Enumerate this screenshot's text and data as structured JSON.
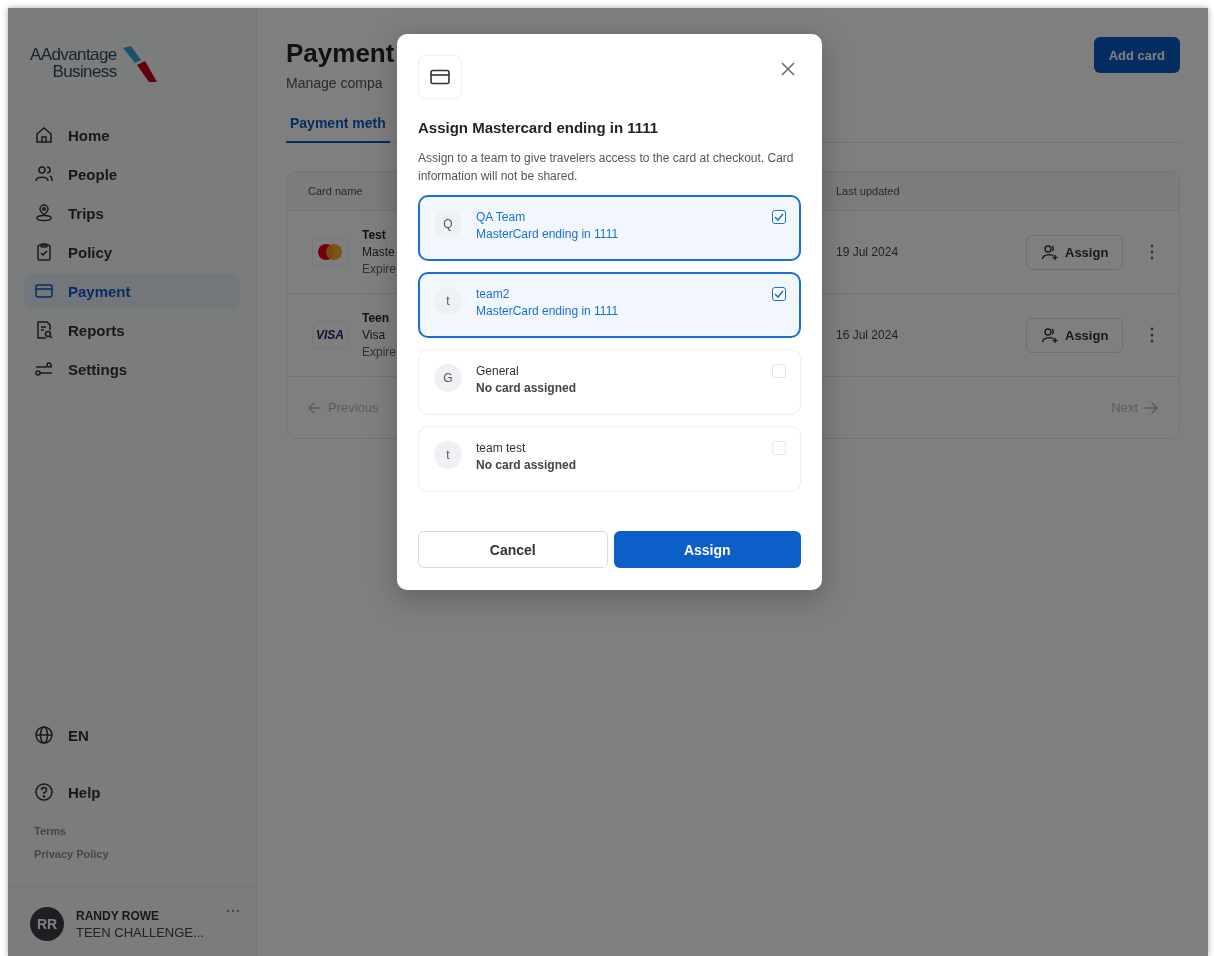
{
  "sidebar": {
    "logo": {
      "line_1": "AAdvantage",
      "line_2": "Business"
    },
    "nav": [
      {
        "label": "Home",
        "selected": false
      },
      {
        "label": "People",
        "selected": false
      },
      {
        "label": "Trips",
        "selected": false
      },
      {
        "label": "Policy",
        "selected": false
      },
      {
        "label": "Payment",
        "selected": true
      },
      {
        "label": "Reports",
        "selected": false
      },
      {
        "label": "Settings",
        "selected": false
      }
    ],
    "language": "EN",
    "help": "Help",
    "links": [
      "Terms",
      "Privacy Policy"
    ],
    "user": {
      "initials": "RR",
      "name": "RANDY ROWE",
      "org": "TEEN CHALLENGE..."
    }
  },
  "page": {
    "title": "Payment",
    "subtitle": "Manage compa",
    "add_button": "Add card",
    "tab": {
      "label": "Payment meth",
      "selected": true
    }
  },
  "table": {
    "columns": [
      "Card name",
      "Last updated"
    ],
    "rows": [
      {
        "kind": "mastercard",
        "name": "Test",
        "line_2": "Maste",
        "line_3": "Expire",
        "updated": "19 Jul 2024",
        "action": "Assign"
      },
      {
        "kind": "visa",
        "logo": "VISA",
        "name": "Teen",
        "line_2": "Visa",
        "line_3": "Expire",
        "updated": "16 Jul 2024",
        "action": "Assign"
      }
    ],
    "previous": "Previous",
    "next": "Next"
  },
  "dialog": {
    "title": "Assign Mastercard ending in 1111",
    "description": "Assign to a team to give travelers access to the card at checkout. Card information will not be shared.",
    "teams": [
      {
        "initial": "Q",
        "name": "QA Team",
        "card": "MasterCard ending in 1111",
        "checked": true
      },
      {
        "initial": "t",
        "name": "team2",
        "card": "MasterCard ending in 1111",
        "checked": true
      },
      {
        "initial": "G",
        "name": "General",
        "card": "No card assigned",
        "checked": false
      },
      {
        "initial": "t",
        "name": "team test",
        "card": "No card assigned",
        "checked": false
      }
    ],
    "cancel": "Cancel",
    "confirm": "Assign"
  }
}
